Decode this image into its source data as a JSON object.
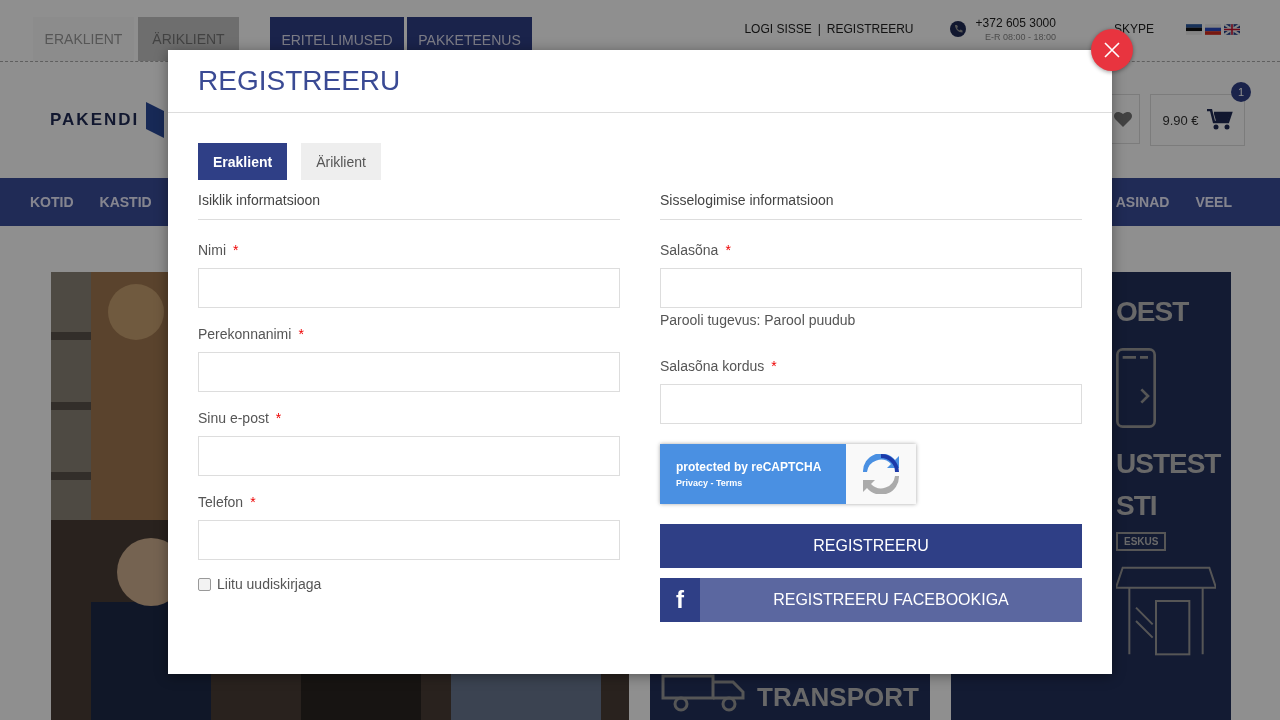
{
  "top_bar": {
    "customer_tabs": [
      {
        "label": "ERAKLIENT",
        "selected": true
      },
      {
        "label": "ÄRIKLIENT",
        "selected": false
      }
    ],
    "service_buttons": [
      "ERITELLIMUSED",
      "PAKKETEENUS"
    ],
    "account_links": [
      "LOGI SISSE",
      "REGISTREERU"
    ],
    "separator": "|",
    "phone": "+372 605 3000",
    "hours": "E-R 08:00 - 18:00",
    "skype": "SKYPE"
  },
  "header": {
    "logo": "PAKENDI",
    "cart_total": "9.90 €",
    "cart_count": "1"
  },
  "nav": [
    "KOTID",
    "KASTID",
    "ASINAD",
    "VEEL"
  ],
  "banners": {
    "right_lines": [
      "OEST",
      "USTEST",
      "STI"
    ],
    "right_sign": "ESKUS",
    "bottom": "TRANSPORT"
  },
  "modal": {
    "title": "REGISTREERU",
    "required_mark": "*",
    "tabs": [
      {
        "label": "Eraklient",
        "selected": true
      },
      {
        "label": "Äriklient",
        "selected": false
      }
    ],
    "left": {
      "heading": "Isiklik informatsioon",
      "fields": [
        {
          "label": "Nimi",
          "required": true
        },
        {
          "label": "Perekonnanimi",
          "required": true
        },
        {
          "label": "Sinu e-post",
          "required": true
        },
        {
          "label": "Telefon",
          "required": true
        }
      ],
      "checkbox": {
        "label": "Liitu uudiskirjaga",
        "checked": false
      }
    },
    "right": {
      "heading": "Sisselogimise informatsioon",
      "fields": [
        {
          "label": "Salasõna",
          "required": true,
          "note": "Parooli tugevus: Parool puudub"
        },
        {
          "label": "Salasõna kordus",
          "required": true
        }
      ]
    },
    "recaptcha": {
      "text": "protected by reCAPTCHA",
      "links": "Privacy - Terms"
    },
    "submit": "REGISTREERU",
    "facebook_icon": "f",
    "facebook": "REGISTREERU FACEBOOKIGA"
  }
}
